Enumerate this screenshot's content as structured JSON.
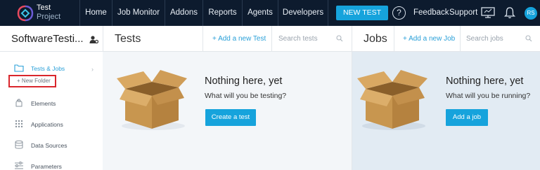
{
  "brand": {
    "line1": "Test",
    "line2": "Project"
  },
  "nav": {
    "items": [
      "Home",
      "Job Monitor",
      "Addons",
      "Reports",
      "Agents",
      "Developers"
    ],
    "new_test": "NEW TEST",
    "help": "?",
    "feedback": "Feedback",
    "support": "Support",
    "avatar": "RS"
  },
  "project": {
    "name": "SoftwareTesti..."
  },
  "tests": {
    "title": "Tests",
    "add_link": "+  Add a new Test",
    "search_placeholder": "Search tests",
    "empty_title": "Nothing here, yet",
    "empty_sub": "What will you be testing?",
    "cta": "Create a test"
  },
  "jobs": {
    "title": "Jobs",
    "add_link": "+  Add a new Job",
    "search_placeholder": "Search jobs",
    "empty_title": "Nothing here, yet",
    "empty_sub": "What will you be running?",
    "cta": "Add a job"
  },
  "sidebar": {
    "tests_jobs": "Tests & Jobs",
    "new_folder": "+ New Folder",
    "items": [
      "Elements",
      "Applications",
      "Data Sources",
      "Parameters"
    ]
  },
  "colors": {
    "nav_bg": "#0d1b2e",
    "accent": "#16a3dc",
    "highlight_border": "#d9262c"
  }
}
